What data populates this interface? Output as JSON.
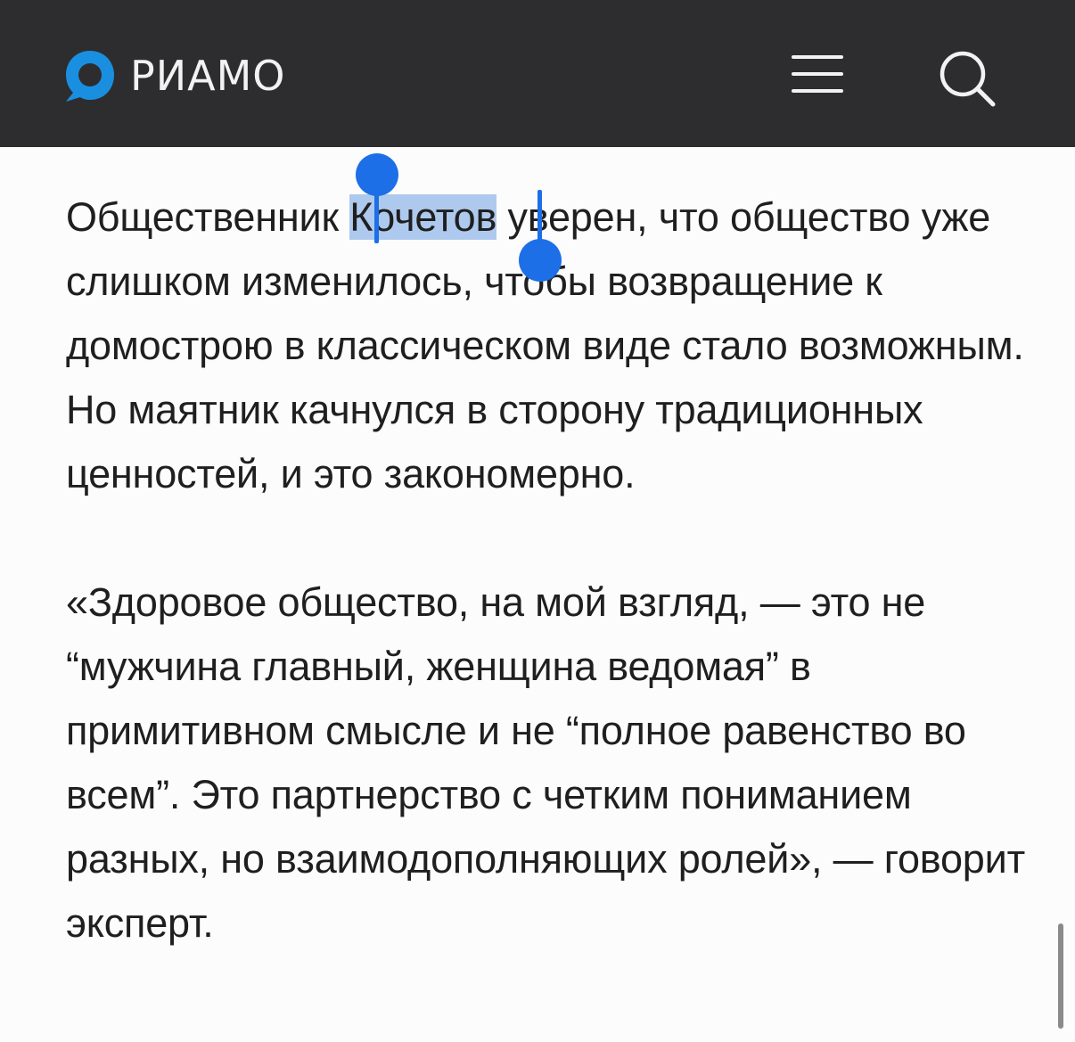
{
  "header": {
    "brand": "PИAMO",
    "icons": {
      "menu": "hamburger-menu-icon",
      "search": "search-icon",
      "logo": "logo-mark-icon"
    },
    "colors": {
      "background": "#2d2d2f",
      "logo_accent": "#1a8fe0",
      "foreground": "#f2f2f2"
    }
  },
  "article": {
    "paragraph1": {
      "before": "Общественник ",
      "selected": "Кочетов",
      "after": " уверен, что общество уже слишком изменилось, чтобы возвращение к домострою в классическом виде стало возможным. Но маятник качнулся в сторону традиционных ценностей, и это закономерно."
    },
    "paragraph2": "«Здоровое общество, на мой взгляд, — это не “мужчина главный, женщина ведомая” в примитивном смысле и не “полное равенство во всем”. Это партнерство с четким пониманием разных, но взаимодополняющих ролей», — говорит эксперт."
  },
  "selection": {
    "color": "#1c6fe6"
  }
}
